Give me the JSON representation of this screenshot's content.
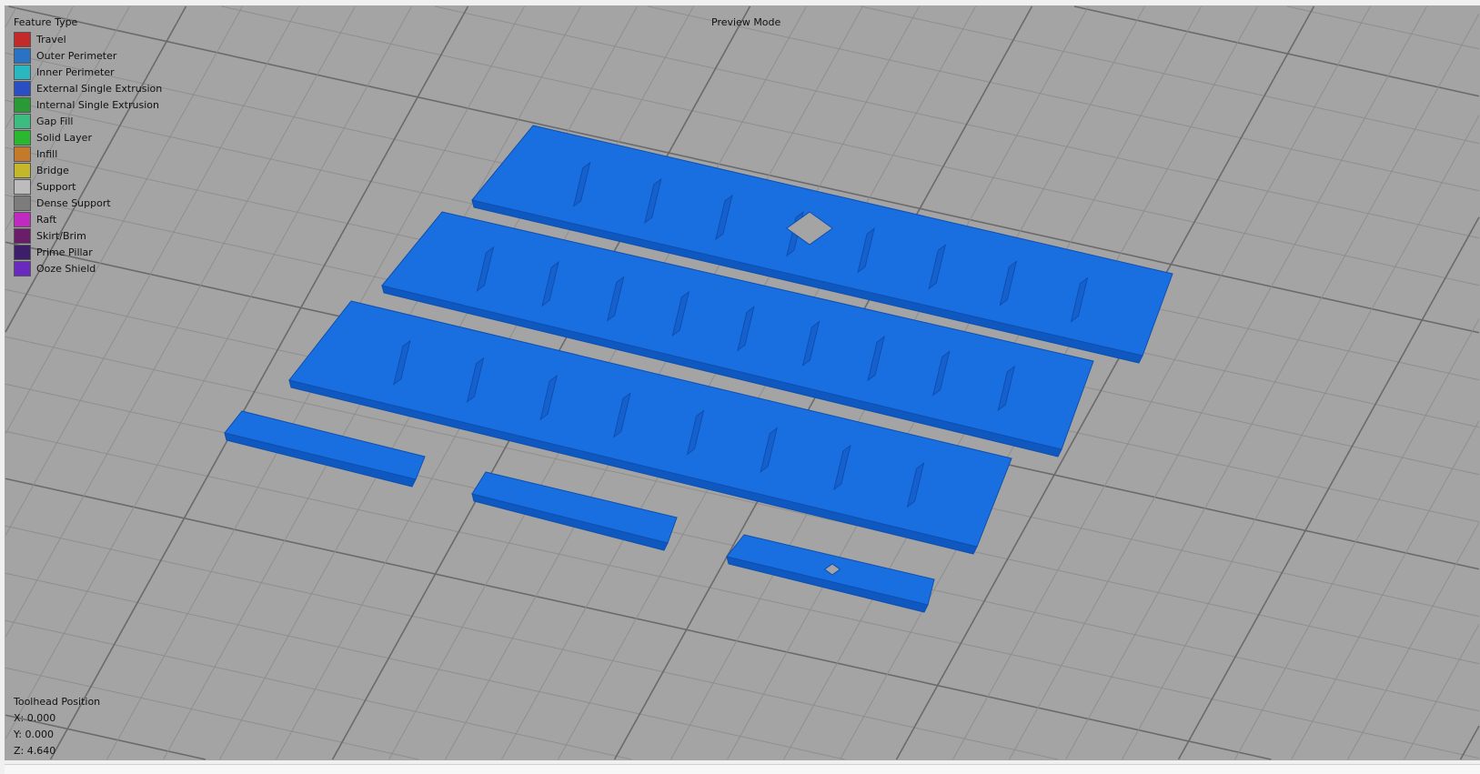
{
  "viewport": {
    "mode_label": "Preview Mode",
    "legend": {
      "title": "Feature Type",
      "items": [
        {
          "label": "Travel",
          "color": "#c42a2a"
        },
        {
          "label": "Outer Perimeter",
          "color": "#2a72c4"
        },
        {
          "label": "Inner Perimeter",
          "color": "#2ab8c0"
        },
        {
          "label": "External Single Extrusion",
          "color": "#2a4ec4"
        },
        {
          "label": "Internal Single Extrusion",
          "color": "#2a9a36"
        },
        {
          "label": "Gap Fill",
          "color": "#3cbc80"
        },
        {
          "label": "Solid Layer",
          "color": "#2ab830"
        },
        {
          "label": "Infill",
          "color": "#c47a2a"
        },
        {
          "label": "Bridge",
          "color": "#c4b82a"
        },
        {
          "label": "Support",
          "color": "#bcbcbc"
        },
        {
          "label": "Dense Support",
          "color": "#7c7c7c"
        },
        {
          "label": "Raft",
          "color": "#c02ac0"
        },
        {
          "label": "Skirt/Brim",
          "color": "#6a1e6a"
        },
        {
          "label": "Prime Pillar",
          "color": "#3c1e6a"
        },
        {
          "label": "Ooze Shield",
          "color": "#6a2ac0"
        }
      ]
    },
    "toolhead": {
      "title": "Toolhead Position",
      "x": "X: 0.000",
      "y": "Y: 0.000",
      "z": "Z: 4.640"
    },
    "model_color": "#1a6fe0"
  }
}
